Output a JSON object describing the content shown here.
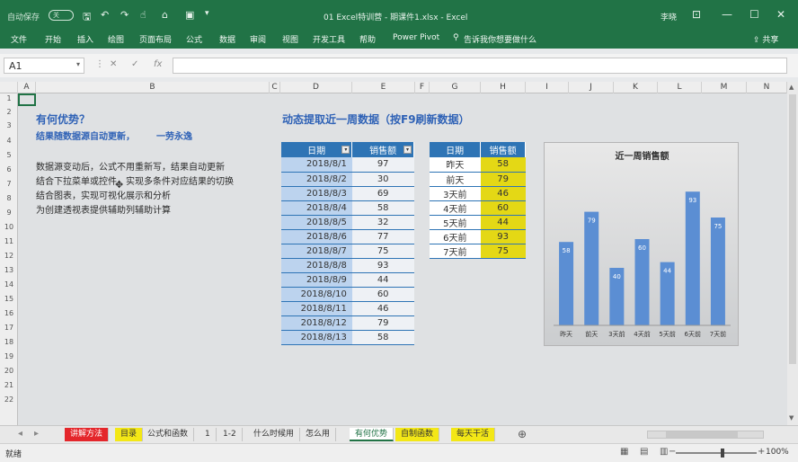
{
  "titlebar": {
    "autosave_label": "自动保存",
    "autosave_state": "关",
    "document_title": "01 Excel特训营 - 期课件1.xlsx - Excel",
    "user": "李晓",
    "minimize": "—",
    "restore": "☐",
    "close": "✕"
  },
  "ribbon": {
    "tabs": [
      "文件",
      "开始",
      "插入",
      "绘图",
      "页面布局",
      "公式",
      "数据",
      "审阅",
      "视图",
      "开发工具",
      "帮助",
      "Power Pivot"
    ],
    "tell_me": "告诉我你想要做什么",
    "share": "共享"
  },
  "formula_bar": {
    "name_box": "A1",
    "formula": "",
    "fx": "fx"
  },
  "columns": [
    "A",
    "B",
    "C",
    "D",
    "E",
    "F",
    "G",
    "H",
    "I",
    "J",
    "K",
    "L",
    "M",
    "N"
  ],
  "rows": [
    "1",
    "2",
    "3",
    "4",
    "5",
    "6",
    "7",
    "8",
    "9",
    "10",
    "11",
    "12",
    "13",
    "14",
    "15",
    "16",
    "17",
    "18",
    "19",
    "20",
    "21",
    "22"
  ],
  "left_panel": {
    "title": "有何优势？",
    "subtitle": "结果随数据源自动更新，",
    "subtitle_tail": "一劳永逸",
    "lines": [
      "数据源变动后，公式不用重新写，结果自动更新",
      "结合下拉菜单或控件，实现多条件对应结果的切换",
      "结合图表，实现可视化展示和分析",
      "为创建透视表提供辅助列辅助计算"
    ]
  },
  "dynamic_title": "动态提取近一周数据（按F9刷新数据）",
  "table1": {
    "headers": [
      "日期",
      "销售额"
    ],
    "rows": [
      [
        "2018/8/1",
        "97"
      ],
      [
        "2018/8/2",
        "30"
      ],
      [
        "2018/8/3",
        "69"
      ],
      [
        "2018/8/4",
        "58"
      ],
      [
        "2018/8/5",
        "32"
      ],
      [
        "2018/8/6",
        "77"
      ],
      [
        "2018/8/7",
        "75"
      ],
      [
        "2018/8/8",
        "93"
      ],
      [
        "2018/8/9",
        "44"
      ],
      [
        "2018/8/10",
        "60"
      ],
      [
        "2018/8/11",
        "46"
      ],
      [
        "2018/8/12",
        "79"
      ],
      [
        "2018/8/13",
        "58"
      ]
    ]
  },
  "table2": {
    "headers": [
      "日期",
      "销售额"
    ],
    "rows": [
      [
        "昨天",
        "58"
      ],
      [
        "前天",
        "79"
      ],
      [
        "3天前",
        "46"
      ],
      [
        "4天前",
        "60"
      ],
      [
        "5天前",
        "44"
      ],
      [
        "6天前",
        "93"
      ],
      [
        "7天前",
        "75"
      ]
    ]
  },
  "chart_data": {
    "type": "bar",
    "title": "近一周销售额",
    "categories": [
      "昨天",
      "前天",
      "3天前",
      "4天前",
      "5天前",
      "6天前",
      "7天前"
    ],
    "values": [
      58,
      79,
      40,
      60,
      44,
      93,
      75
    ],
    "ylim": [
      0,
      100
    ],
    "grid": false,
    "bar_color": "#5b8ed3",
    "label_color": "#ffffff"
  },
  "sheet_tabs": [
    {
      "label": "讲解方法",
      "style": "red"
    },
    {
      "label": "目录",
      "style": "yel"
    },
    {
      "label": "公式和函数",
      "style": ""
    },
    {
      "label": "1",
      "style": ""
    },
    {
      "label": "1-2",
      "style": ""
    },
    {
      "label": "什么时候用",
      "style": ""
    },
    {
      "label": "怎么用",
      "style": ""
    },
    {
      "label": "有何优势",
      "style": "active"
    },
    {
      "label": "自制函数",
      "style": "yel"
    },
    {
      "label": "每天干活",
      "style": "yel"
    }
  ],
  "add_sheet": "⊕",
  "status": {
    "ready": "就绪",
    "zoom": "100%"
  },
  "colors": {
    "excel_green": "#217346",
    "table_header": "#2e74b5",
    "highlight_yellow": "#e4d815"
  }
}
